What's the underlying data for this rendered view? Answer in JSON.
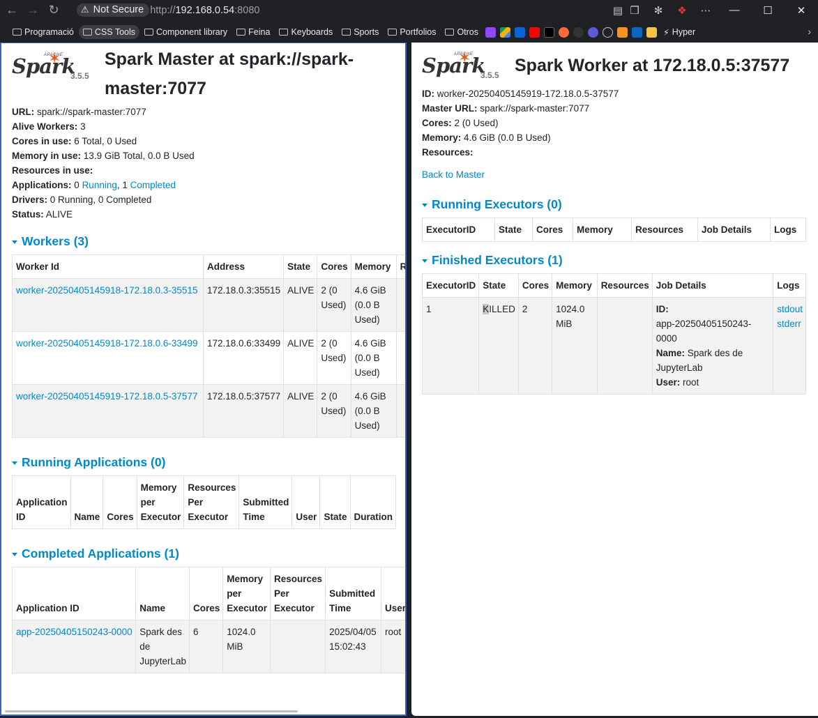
{
  "browser": {
    "security_label": "Not Secure",
    "url_scheme": "http://",
    "url_host": "192.168.0.54",
    "url_port": ":8080",
    "bookmarks": [
      "Programació",
      "CSS Tools",
      "Component library",
      "Feina",
      "Keyboards",
      "Sports",
      "Portfolios",
      "Otros"
    ],
    "bookmark_last": "Hyper"
  },
  "master": {
    "version": "3.5.5",
    "title": "Spark Master at spark://spark-master:7077",
    "url_label": "URL:",
    "url_value": "spark://spark-master:7077",
    "alive_label": "Alive Workers:",
    "alive_value": "3",
    "cores_label": "Cores in use:",
    "cores_value": "6 Total, 0 Used",
    "mem_label": "Memory in use:",
    "mem_value": "13.9 GiB Total, 0.0 B Used",
    "res_label": "Resources in use:",
    "apps_label": "Applications:",
    "apps_running_count": "0",
    "apps_running_link": "Running",
    "apps_sep": ",",
    "apps_completed_count": "1",
    "apps_completed_link": "Completed",
    "drivers_label": "Drivers:",
    "drivers_value": "0 Running, 0 Completed",
    "status_label": "Status:",
    "status_value": "ALIVE",
    "workers_title": "Workers (3)",
    "workers_headers": [
      "Worker Id",
      "Address",
      "State",
      "Cores",
      "Memory",
      "Res"
    ],
    "workers": [
      {
        "id": "worker-20250405145918-172.18.0.3-35515",
        "address": "172.18.0.3:35515",
        "state": "ALIVE",
        "cores": "2 (0 Used)",
        "memory": "4.6 GiB (0.0 B Used)"
      },
      {
        "id": "worker-20250405145918-172.18.0.6-33499",
        "address": "172.18.0.6:33499",
        "state": "ALIVE",
        "cores": "2 (0 Used)",
        "memory": "4.6 GiB (0.0 B Used)"
      },
      {
        "id": "worker-20250405145919-172.18.0.5-37577",
        "address": "172.18.0.5:37577",
        "state": "ALIVE",
        "cores": "2 (0 Used)",
        "memory": "4.6 GiB (0.0 B Used)"
      }
    ],
    "running_apps_title": "Running Applications (0)",
    "running_apps_headers": [
      "Application ID",
      "Name",
      "Cores",
      "Memory per Executor",
      "Resources Per Executor",
      "Submitted Time",
      "User",
      "State",
      "Duration"
    ],
    "completed_apps_title": "Completed Applications (1)",
    "completed_apps_headers": [
      "Application ID",
      "Name",
      "Cores",
      "Memory per Executor",
      "Resources Per Executor",
      "Submitted Time",
      "User"
    ],
    "completed_apps": [
      {
        "id": "app-20250405150243-0000",
        "name": "Spark des de JupyterLab",
        "cores": "6",
        "memory": "1024.0 MiB",
        "resources": "",
        "submitted": "2025/04/05 15:02:43",
        "user": "root"
      }
    ]
  },
  "worker": {
    "version": "3.5.5",
    "title": "Spark Worker at 172.18.0.5:37577",
    "id_label": "ID:",
    "id_value": "worker-20250405145919-172.18.0.5-37577",
    "master_label": "Master URL:",
    "master_value": "spark://spark-master:7077",
    "cores_label": "Cores:",
    "cores_value": "2 (0 Used)",
    "mem_label": "Memory:",
    "mem_value": "4.6 GiB (0.0 B Used)",
    "res_label": "Resources:",
    "back_link": "Back to Master",
    "running_title": "Running Executors (0)",
    "exec_headers": [
      "ExecutorID",
      "State",
      "Cores",
      "Memory",
      "Resources",
      "Job Details",
      "Logs"
    ],
    "finished_title": "Finished Executors (1)",
    "finished": [
      {
        "id": "1",
        "state_k": "K",
        "state_rest": "ILLED",
        "cores": "2",
        "memory": "1024.0 MiB",
        "resources": "",
        "job_id_label": "ID:",
        "job_id": "app-20250405150243-0000",
        "job_name_label": "Name:",
        "job_name": "Spark des de JupyterLab",
        "job_user_label": "User:",
        "job_user": "root",
        "log_out": "stdout",
        "log_err": "stderr"
      }
    ]
  }
}
